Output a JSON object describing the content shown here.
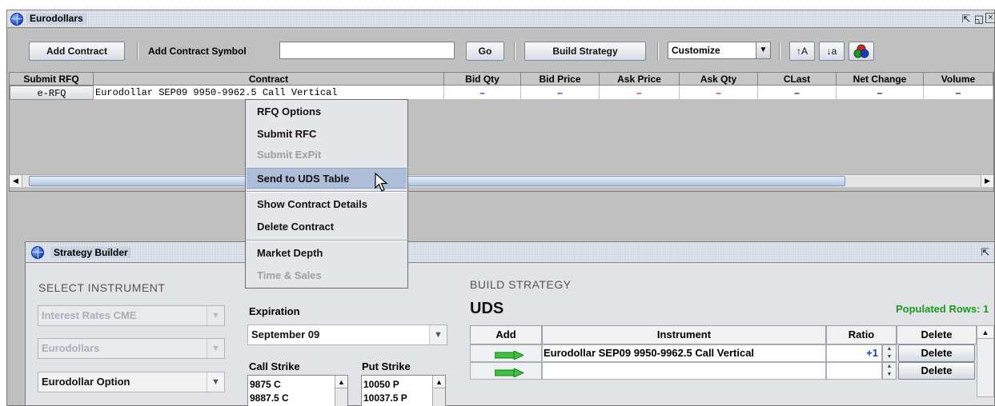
{
  "eurodollars_window": {
    "title": "Eurodollars",
    "toolbar": {
      "add_contract": "Add Contract",
      "add_contract_symbol_label": "Add Contract Symbol",
      "symbol_value": "",
      "go": "Go",
      "build_strategy": "Build Strategy",
      "customize": "Customize",
      "sort_asc": "↑A",
      "sort_desc": "↓a"
    },
    "table": {
      "columns": [
        "Submit RFQ",
        "Contract",
        "Bid Qty",
        "Bid Price",
        "Ask Price",
        "Ask Qty",
        "CLast",
        "Net Change",
        "Volume"
      ],
      "row": {
        "submit_rfq": "e-RFQ",
        "contract": "Eurodollar SEP09 9950-9962.5 Call Vertical",
        "bid_qty": "–",
        "bid_price": "–",
        "ask_price": "–",
        "ask_qty": "–",
        "clast": "–",
        "net_change": "–",
        "volume": "–"
      }
    }
  },
  "context_menu": {
    "items": [
      {
        "label": "RFQ Options",
        "enabled": true
      },
      {
        "label": "Submit RFC",
        "enabled": true
      },
      {
        "label": "Submit ExPit",
        "enabled": false
      },
      {
        "label": "Send to UDS Table",
        "enabled": true,
        "highlighted": true
      },
      {
        "label": "Show Contract Details",
        "enabled": true
      },
      {
        "label": "Delete Contract",
        "enabled": true
      },
      {
        "label": "Market Depth",
        "enabled": true
      },
      {
        "label": "Time & Sales",
        "enabled": false
      }
    ]
  },
  "strategy_builder": {
    "title": "Strategy Builder",
    "select_instrument": "SELECT INSTRUMENT",
    "market": "Interest Rates CME",
    "product": "Eurodollars",
    "instrument_type": "Eurodollar Option",
    "expiration_label": "Expiration",
    "expiration_value": "September 09",
    "call_strike_label": "Call Strike",
    "put_strike_label": "Put Strike",
    "call_strikes": [
      "9875 C",
      "9887.5 C"
    ],
    "put_strikes": [
      "10050 P",
      "10037.5 P"
    ],
    "build_strategy": "BUILD STRATEGY",
    "uds": "UDS",
    "populated_rows": "Populated Rows: 1",
    "grid_columns": [
      "Add",
      "Instrument",
      "Ratio",
      "Delete"
    ],
    "rows": [
      {
        "instrument": "Eurodollar SEP09 9950-9962.5 Call Vertical",
        "ratio": "+1",
        "delete": "Delete"
      },
      {
        "instrument": "",
        "ratio": "",
        "delete": "Delete"
      }
    ]
  },
  "colors": {
    "accent_green": "#1a9a1a",
    "positive_blue": "#1a38c8",
    "negative_red": "#e02020",
    "highlight": "#aebed8"
  }
}
